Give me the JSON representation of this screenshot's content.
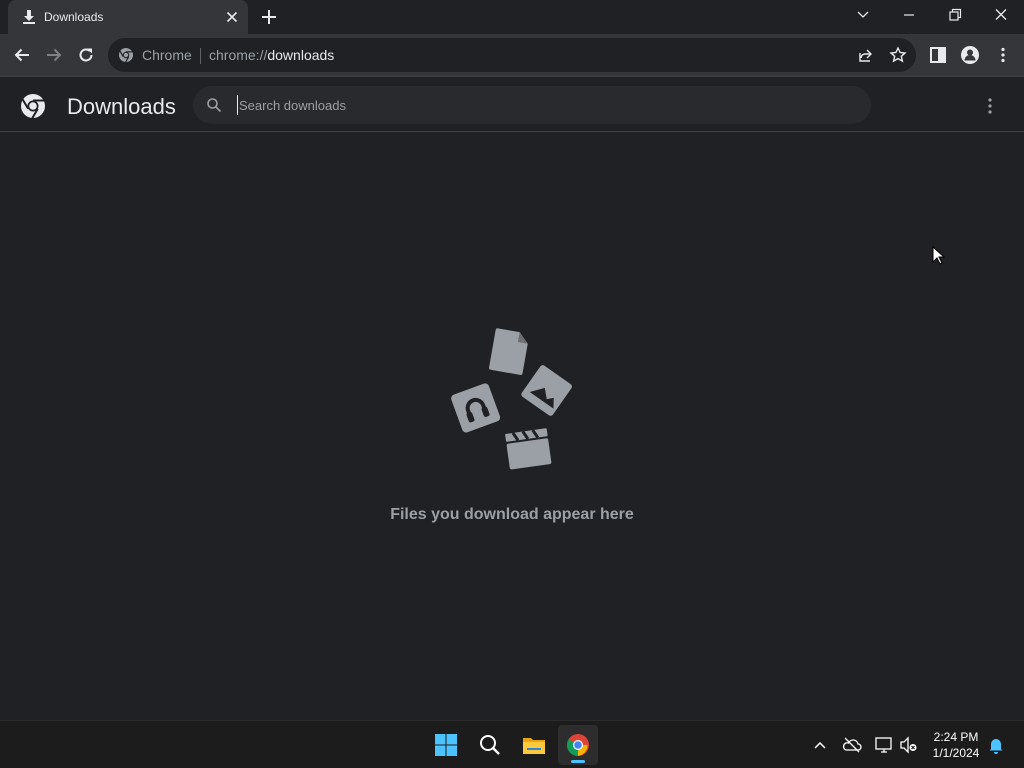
{
  "tab": {
    "title": "Downloads"
  },
  "omnibox": {
    "chip": "Chrome",
    "url_scheme": "chrome://",
    "url_path": "downloads"
  },
  "page": {
    "title": "Downloads",
    "search_placeholder": "Search downloads",
    "empty_message": "Files you download appear here"
  },
  "taskbar": {
    "time": "2:24 PM",
    "date": "1/1/2024"
  },
  "colors": {
    "background": "#202124",
    "toolbar": "#35363a",
    "text": "#e8eaed",
    "muted": "#9aa0a6",
    "accent": "#4cc2ff"
  },
  "icons": [
    "download-icon",
    "close-icon",
    "plus-icon",
    "chevron-down-icon",
    "minimize-icon",
    "restore-icon",
    "back-icon",
    "forward-icon",
    "reload-icon",
    "share-icon",
    "star-icon",
    "side-panel-icon",
    "profile-icon",
    "more-vert-icon",
    "chrome-logo-icon",
    "search-icon",
    "windows-start-icon",
    "file-explorer-icon",
    "chrome-app-icon",
    "chevron-up-icon",
    "onedrive-icon",
    "network-icon",
    "volume-muted-icon",
    "bell-icon"
  ]
}
